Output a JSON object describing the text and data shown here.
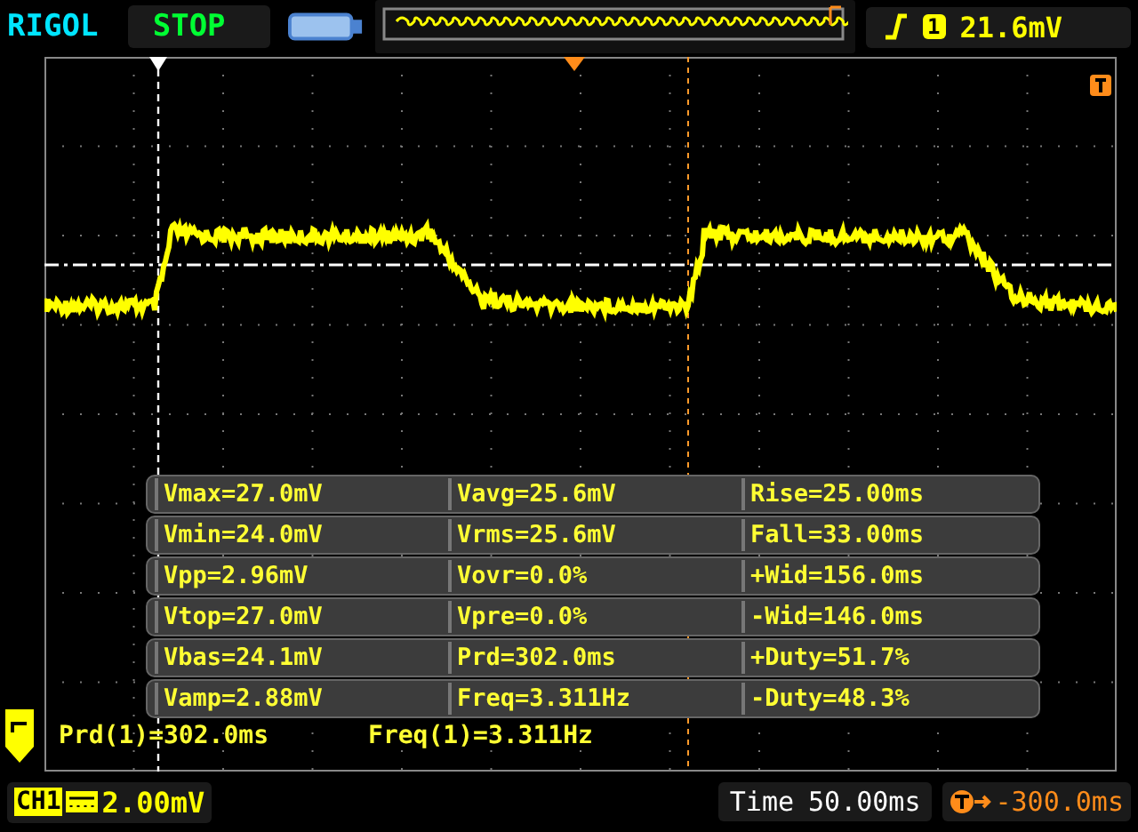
{
  "header": {
    "brand": "RIGOL",
    "run_state": "STOP",
    "trigger_channel": "1",
    "trigger_level": "21.6mV"
  },
  "measurements": [
    [
      "Vmax=27.0mV",
      "Vavg=25.6mV",
      "Rise=25.00ms"
    ],
    [
      "Vmin=24.0mV",
      "Vrms=25.6mV",
      "Fall=33.00ms"
    ],
    [
      "Vpp=2.96mV",
      "Vovr=0.0%",
      "+Wid=156.0ms"
    ],
    [
      "Vtop=27.0mV",
      "Vpre=0.0%",
      "-Wid=146.0ms"
    ],
    [
      "Vbas=24.1mV",
      "Prd=302.0ms",
      "+Duty=51.7%"
    ],
    [
      "Vamp=2.88mV",
      "Freq=3.311Hz",
      "-Duty=48.3%"
    ]
  ],
  "readouts": [
    "Prd(1)=302.0ms",
    "Freq(1)=3.311Hz"
  ],
  "footer": {
    "channel": "CH1",
    "vertical_scale": "2.00mV",
    "time_label": "Time",
    "time_scale": "50.00ms",
    "trigger_offset": "-300.0ms"
  }
}
